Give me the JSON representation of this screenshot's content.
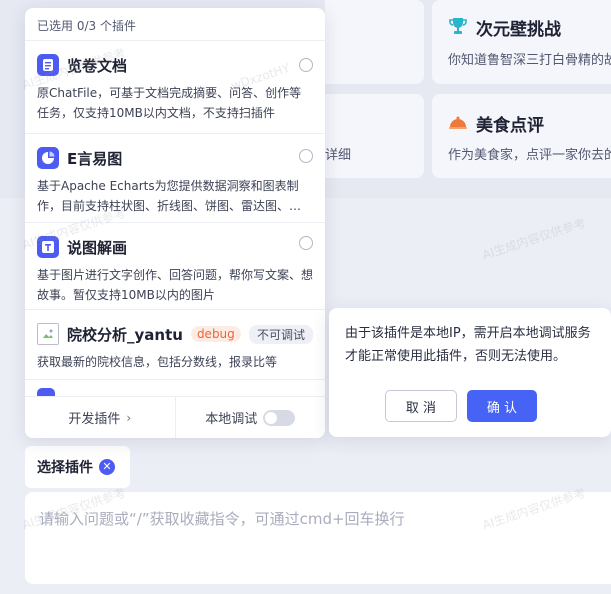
{
  "background": {
    "cards": [
      {
        "title": "次元壁挑战",
        "desc": "你知道鲁智深三打白骨精的故"
      },
      {
        "title": "美食点评",
        "desc": "作为美食家，点评一家你去的"
      }
    ],
    "partial_text": "详细"
  },
  "plugin_panel": {
    "header": "已选用 0/3 个插件",
    "items": [
      {
        "name": "览卷文档",
        "desc": "原ChatFile，可基于文档完成摘要、问答、创作等任务，仅支持10MB以内文档，不支持扫插件",
        "icon": "document-icon"
      },
      {
        "name": "E言易图",
        "desc": "基于Apache Echarts为您提供数据洞察和图表制作，目前支持柱状图、折线图、饼图、雷达图、散点图、漏斗图、思维导图（树图）",
        "icon": "pie-chart-icon"
      },
      {
        "name": "说图解画",
        "desc": "基于图片进行文字创作、回答问题，帮你写文案、想故事。暂仅支持10MB以内的图片",
        "icon": "image-text-icon"
      },
      {
        "name": "院校分析_yantu",
        "tag": "debug",
        "status": "不可调试",
        "desc": "获取最新的院校信息，包括分数线，报录比等",
        "icon": "broken-image-icon"
      }
    ],
    "footer": {
      "dev_plugin": "开发插件",
      "local_debug": "本地调试"
    }
  },
  "chip": {
    "label": "选择插件"
  },
  "input": {
    "placeholder": "请输入问题或“/”获取收藏指令，可通过cmd+回车换行"
  },
  "dialog": {
    "message": "由于该插件是本地IP，需开启本地调试服务才能正常使用此插件，否则无法使用。",
    "cancel": "取 消",
    "confirm": "确 认"
  },
  "colors": {
    "accent": "#4763f5",
    "debug_tag": "#e8663b",
    "trophy_icon": "#2bb5c8",
    "food_icon": "#ee7a3a"
  }
}
